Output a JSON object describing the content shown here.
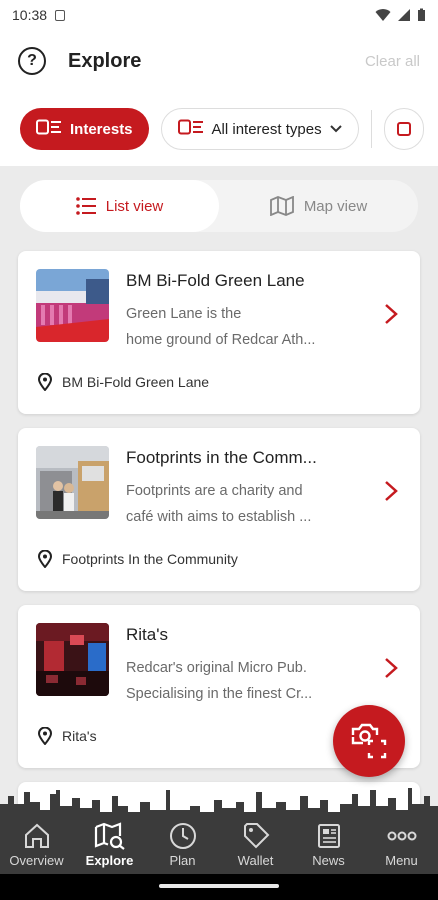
{
  "status": {
    "time": "10:38"
  },
  "header": {
    "title": "Explore",
    "clear_label": "Clear all"
  },
  "filters": {
    "interests_label": "Interests",
    "types_label": "All interest types"
  },
  "view_toggle": {
    "list_label": "List view",
    "map_label": "Map view"
  },
  "cards": [
    {
      "name": "BM Bi-Fold Green Lane",
      "desc_line1": "Green Lane is the",
      "desc_line2": "home ground of Redcar Ath...",
      "location": "BM Bi-Fold Green Lane"
    },
    {
      "name": "Footprints in the Comm...",
      "desc_line1": "Footprints are a charity and",
      "desc_line2": "café with aims to establish ...",
      "location": "Footprints In the Community"
    },
    {
      "name": "Rita's",
      "desc_line1": "Redcar's original Micro Pub.",
      "desc_line2": "Specialising in the finest Cr...",
      "location": "Rita's"
    }
  ],
  "nav": {
    "overview": "Overview",
    "explore": "Explore",
    "plan": "Plan",
    "wallet": "Wallet",
    "news": "News",
    "menu": "Menu"
  },
  "colors": {
    "accent": "#c51a1f",
    "nav_bg": "#3b3b3b"
  },
  "icons": {
    "help": "help-circle-icon",
    "filter": "filter-list-icon",
    "list": "list-icon",
    "map": "map-icon",
    "chevron": "chevron-right-icon",
    "pin": "location-pin-icon",
    "scan": "camera-scan-icon"
  }
}
